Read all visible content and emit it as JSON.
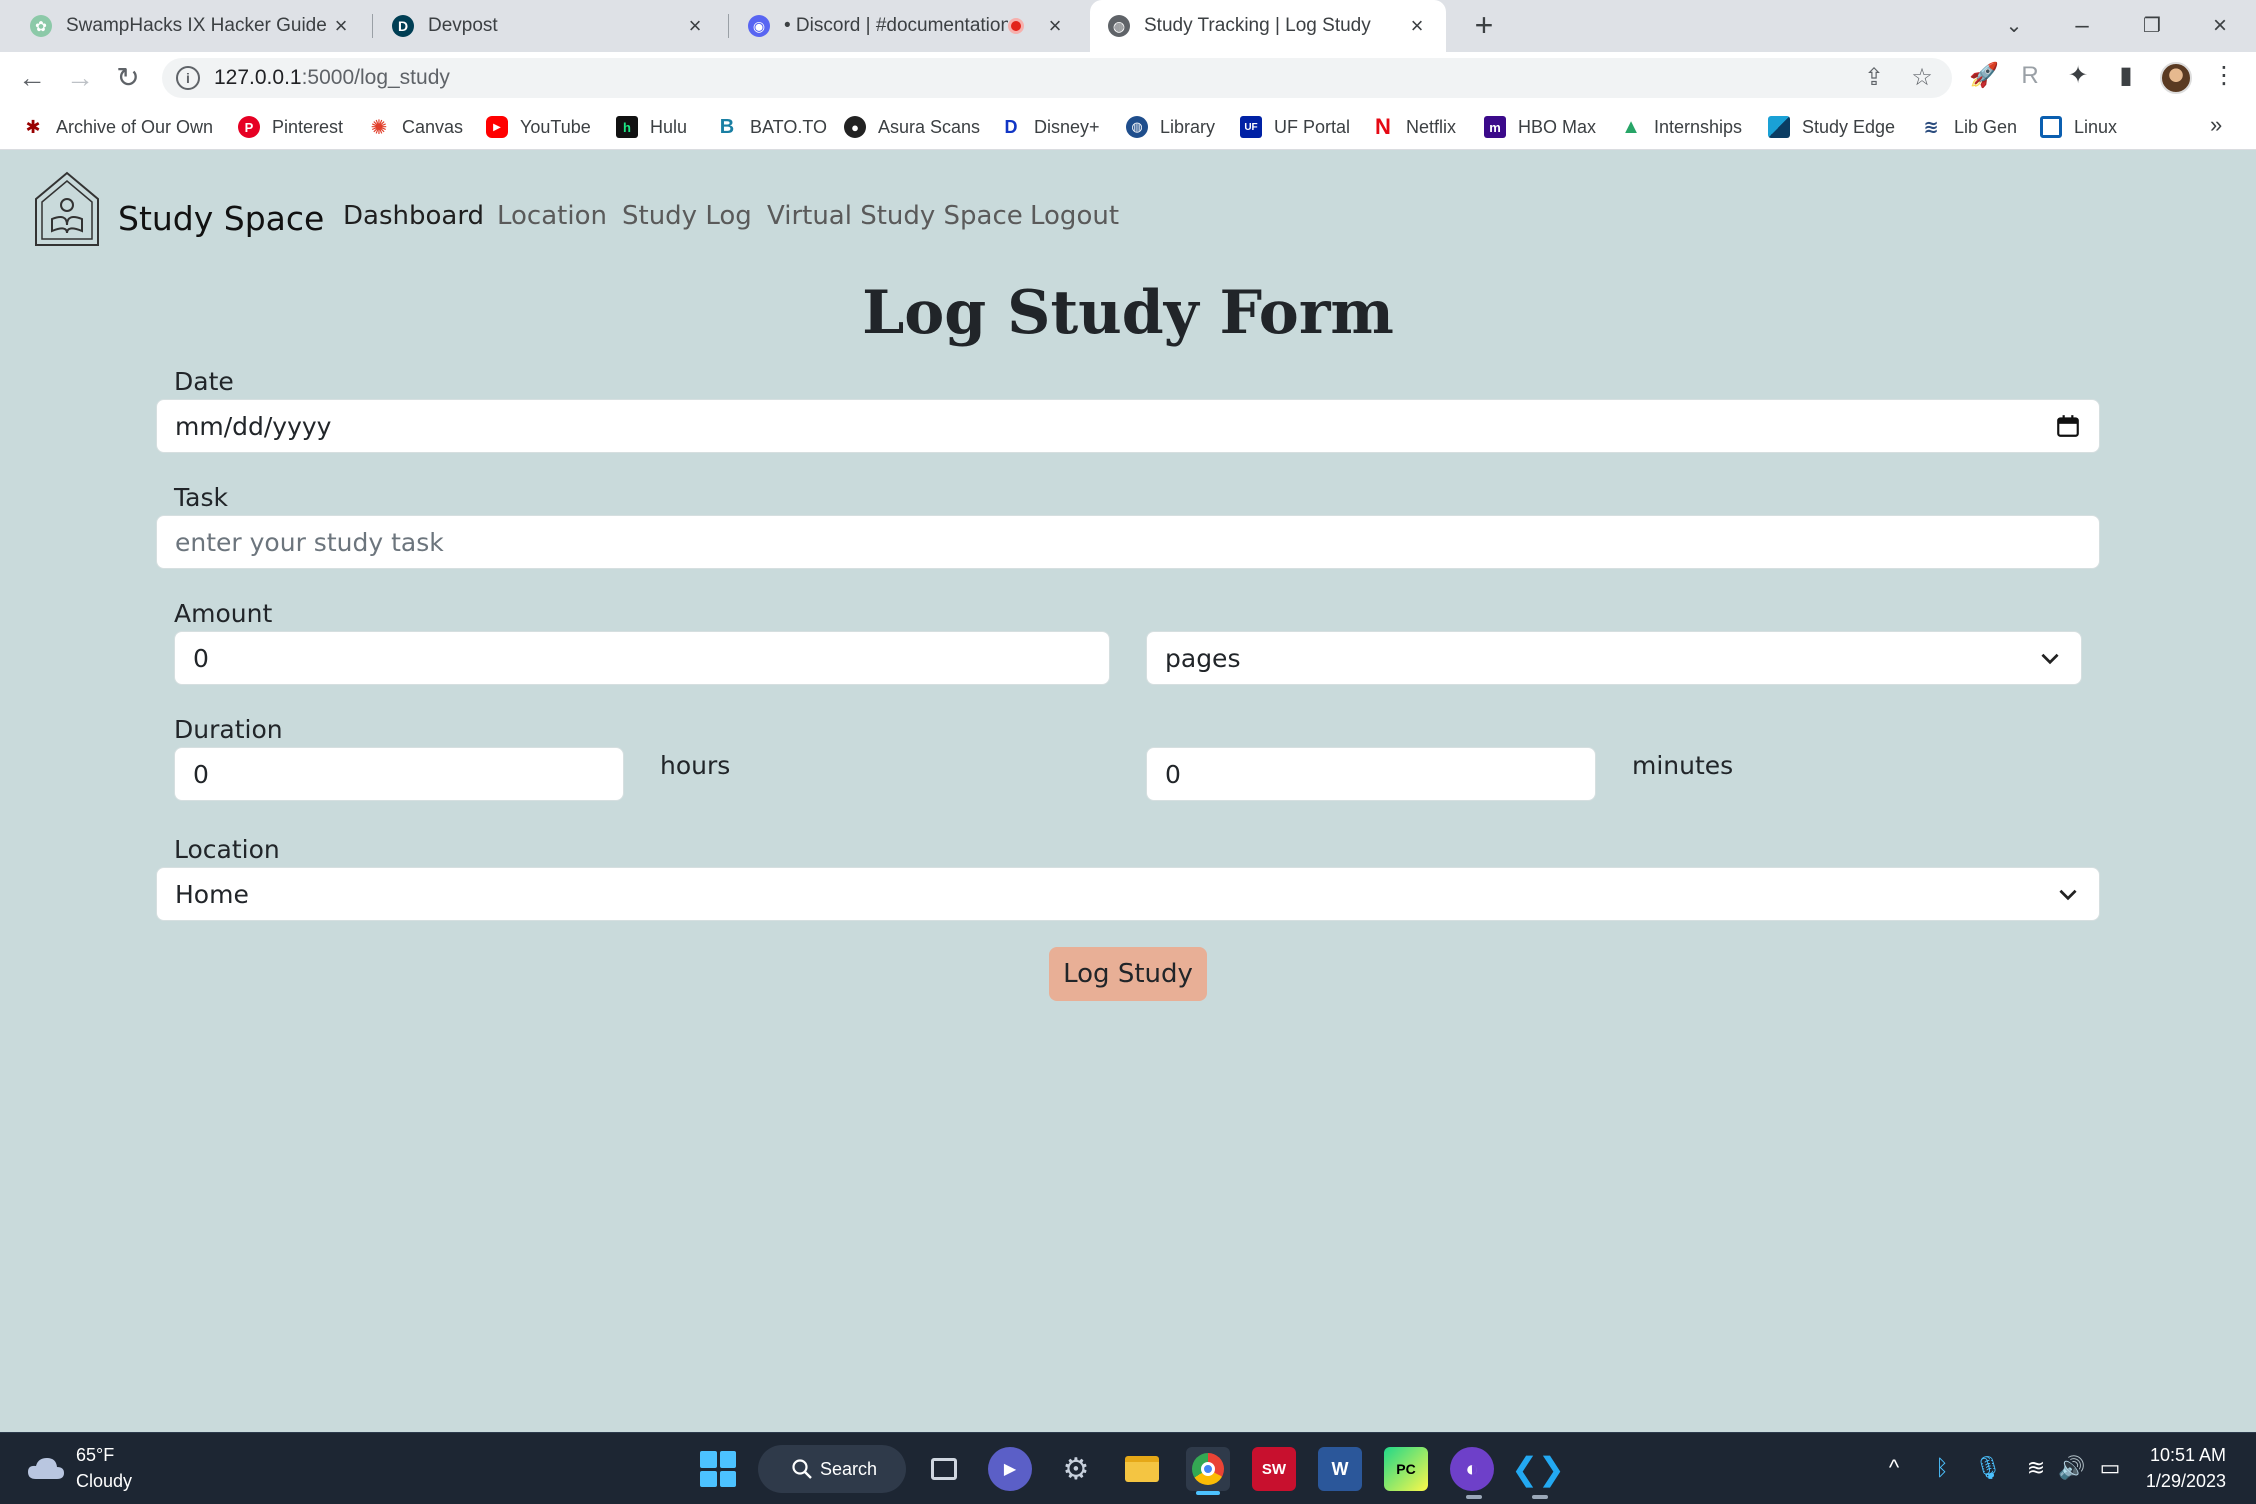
{
  "browser": {
    "tabs": [
      {
        "title": "SwampHacks IX Hacker Guide",
        "active": false
      },
      {
        "title": "Devpost",
        "active": false
      },
      {
        "title": "• Discord | #documentations",
        "active": false
      },
      {
        "title": "Study Tracking | Log Study",
        "active": true
      }
    ],
    "url_host": "127.0.0.1",
    "url_path": ":5000/log_study",
    "bookmarks": [
      "Archive of Our Own",
      "Pinterest",
      "Canvas",
      "YouTube",
      "Hulu",
      "BATO.TO",
      "Asura Scans",
      "Disney+",
      "Library",
      "UF Portal",
      "Netflix",
      "HBO Max",
      "Internships",
      "Study Edge",
      "Lib Gen",
      "Linux"
    ],
    "more_bookmarks": "»"
  },
  "app": {
    "brand": "Study Space",
    "nav": [
      "Dashboard",
      "Location",
      "Study Log",
      "Virtual Study Space",
      "Logout"
    ],
    "form_title": "Log Study Form",
    "date": {
      "label": "Date",
      "value": "mm/dd/yyyy"
    },
    "task": {
      "label": "Task",
      "placeholder": "enter your study task"
    },
    "amount": {
      "label": "Amount",
      "value": "0",
      "unit_selected": "pages"
    },
    "duration": {
      "label": "Duration",
      "hours_value": "0",
      "hours_unit": "hours",
      "minutes_value": "0",
      "minutes_unit": "minutes"
    },
    "location": {
      "label": "Location",
      "selected": "Home"
    },
    "submit_label": "Log Study"
  },
  "taskbar": {
    "weather_temp": "65°F",
    "weather_condition": "Cloudy",
    "search_label": "Search",
    "time": "10:51 AM",
    "date": "1/29/2023"
  },
  "colors": {
    "page_background": "#c9dadb",
    "submit_button": "#e8af96",
    "taskbar": "#1d2633"
  }
}
